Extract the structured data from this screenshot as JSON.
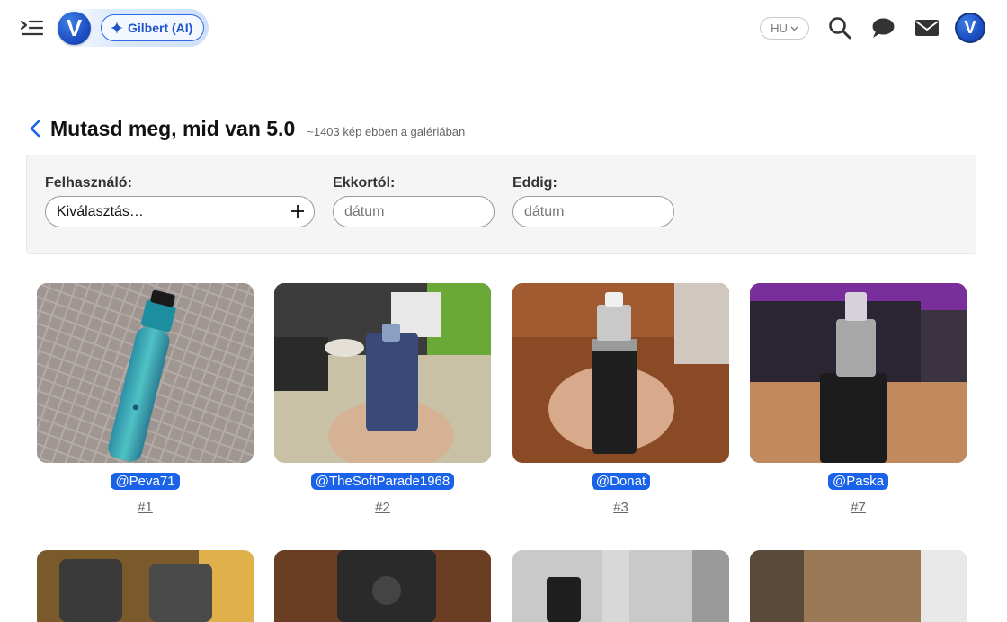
{
  "header": {
    "ai_button_label": "Gilbert (AI)",
    "brand_letter": "V",
    "language": "HU",
    "avatar_letter": "V"
  },
  "page": {
    "title": "Mutasd meg, mid van 5.0",
    "subtitle": "~1403 kép ebben a galériában"
  },
  "filters": {
    "user_label": "Felhasználó:",
    "user_value": "Kiválasztás…",
    "from_label": "Ekkortól:",
    "from_placeholder": "dátum",
    "to_label": "Eddig:",
    "to_placeholder": "dátum"
  },
  "gallery": [
    {
      "user": "@Peva71",
      "number": "#1"
    },
    {
      "user": "@TheSoftParade1968",
      "number": "#2"
    },
    {
      "user": "@Donat",
      "number": "#3"
    },
    {
      "user": "@Paska",
      "number": "#7"
    }
  ],
  "colors": {
    "accent": "#1a63e8",
    "brand": "#1d4fc4"
  },
  "icons": [
    "menu-toggle-icon",
    "sparkle-icon",
    "chevron-down-icon",
    "search-icon",
    "chat-icon",
    "mail-icon",
    "plus-icon",
    "back-chevron-icon"
  ]
}
